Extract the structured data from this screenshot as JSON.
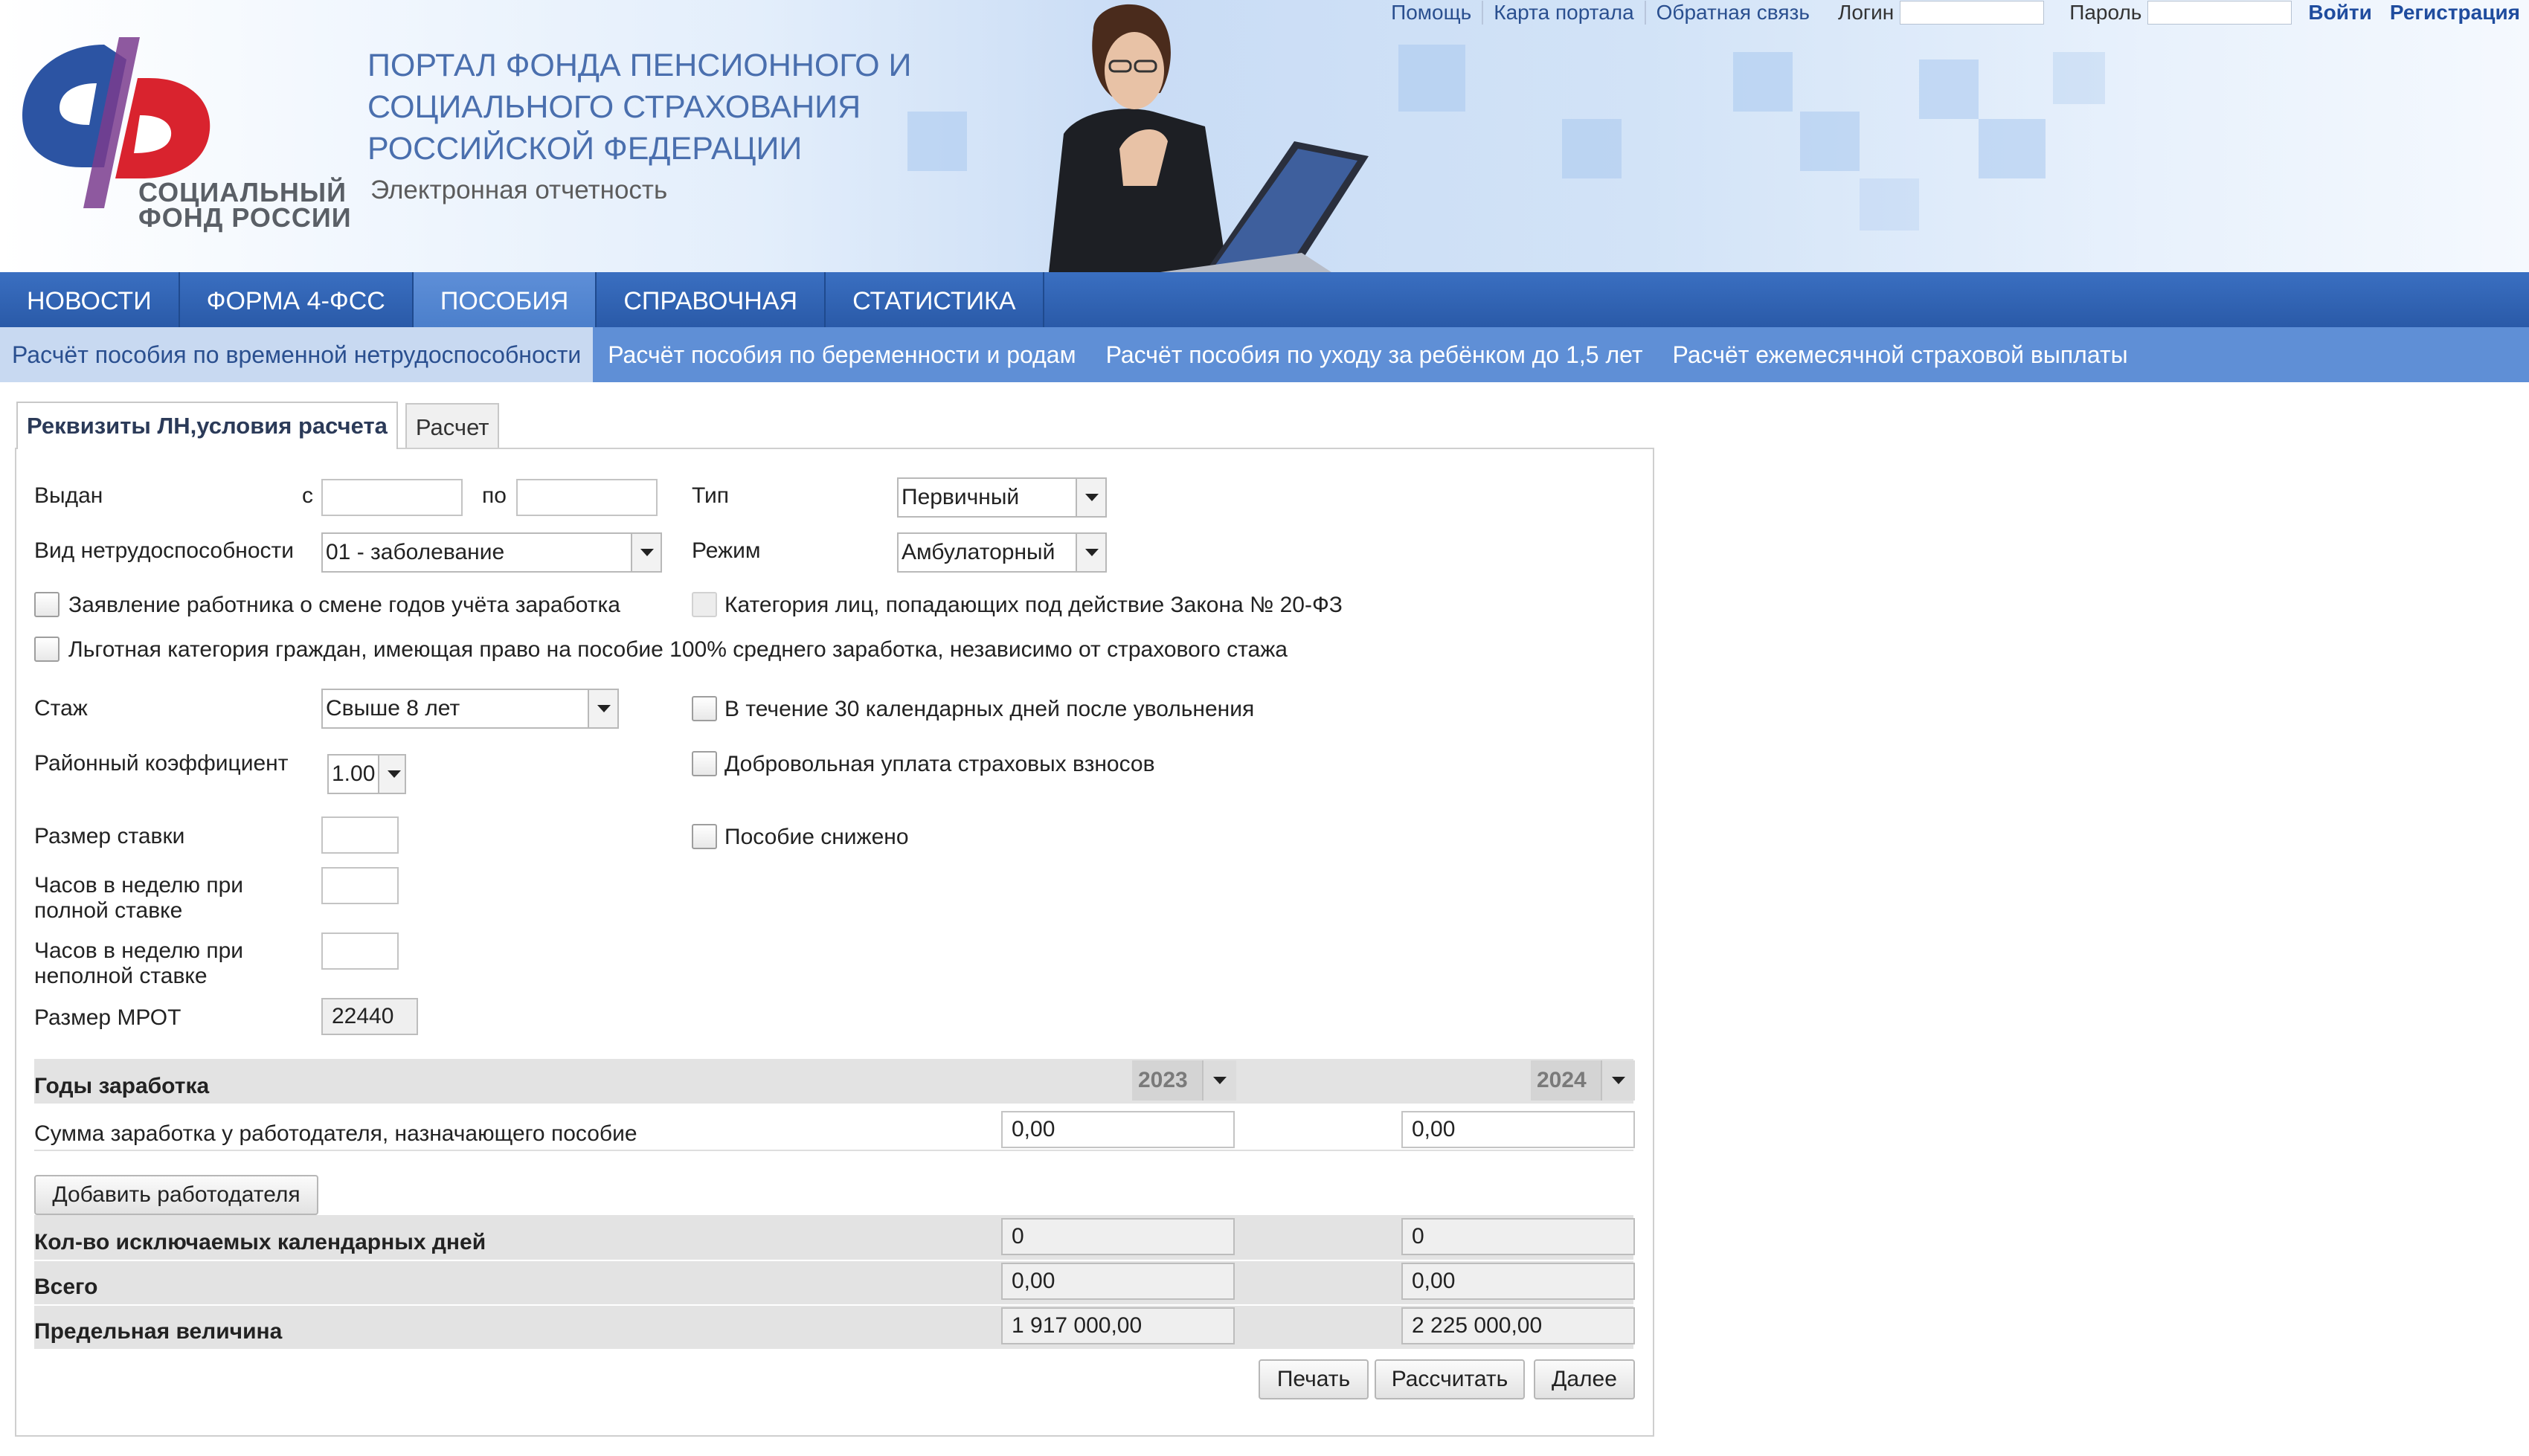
{
  "header": {
    "logo_text_line1": "СОЦИАЛЬНЫЙ",
    "logo_text_line2": "ФОНД РОССИИ",
    "portal_title": "ПОРТАЛ ФОНДА ПЕНСИОННОГО И СОЦИАЛЬНОГО СТРАХОВАНИЯ РОССИЙСКОЙ ФЕДЕРАЦИИ",
    "portal_subtitle": "Электронная отчетность",
    "links": [
      "Помощь",
      "Карта портала",
      "Обратная связь"
    ],
    "login_label": "Логин",
    "password_label": "Пароль",
    "login_button": "Войти",
    "register_button": "Регистрация",
    "colors": {
      "title": "#4a6fae",
      "logo_blue": "#2c54a3",
      "logo_red": "#d9232e"
    }
  },
  "nav": {
    "items": [
      "НОВОСТИ",
      "ФОРМА 4-ФСС",
      "ПОСОБИЯ",
      "СПРАВОЧНАЯ",
      "СТАТИСТИКА"
    ],
    "active": "ПОСОБИЯ"
  },
  "subnav": {
    "items": [
      "Расчёт пособия по временной нетрудоспособности",
      "Расчёт пособия по беременности и родам",
      "Расчёт пособия по уходу за ребёнком до 1,5 лет",
      "Расчёт ежемесячной страховой выплаты"
    ]
  },
  "tabs": {
    "requisites": "Реквизиты ЛН,условия расчета",
    "calc": "Расчет"
  },
  "form": {
    "issued_label": "Выдан",
    "from_label": "с",
    "to_label": "по",
    "issued_from": "",
    "issued_to": "",
    "type_label": "Тип",
    "type_value": "Первичный",
    "disability_label": "Вид нетрудоспособности",
    "disability_value": "01 - заболевание",
    "mode_label": "Режим",
    "mode_value": "Амбулаторный",
    "chk_change_years": "Заявление работника о смене годов учёта заработка",
    "chk_law_20fz": "Категория лиц, попадающих под действие Закона № 20-ФЗ",
    "chk_privileged": "Льготная категория граждан, имеющая право на пособие 100% среднего заработка, независимо от страхового стажа",
    "experience_label": "Стаж",
    "experience_value": "Свыше 8 лет",
    "chk_30days": "В течение 30 календарных дней после увольнения",
    "regional_label": "Районный коэффициент",
    "regional_value": "1.00",
    "chk_voluntary": "Добровольная уплата страховых взносов",
    "rate_label": "Размер ставки",
    "chk_reduced": "Пособие снижено",
    "hours_full_label": "Часов в неделю при полной ставке",
    "hours_part_label": "Часов в неделю при неполной ставке",
    "mrot_label": "Размер МРОТ",
    "mrot_value": "22440"
  },
  "earnings": {
    "years_label": "Годы заработка",
    "year1": "2023",
    "year2": "2024",
    "employer_sum_label": "Сумма заработка у работодателя, назначающего пособие",
    "employer_sum_1": "0,00",
    "employer_sum_2": "0,00",
    "add_employer_button": "Добавить работодателя",
    "excluded_days_label": "Кол-во исключаемых календарных дней",
    "excluded_days_1": "0",
    "excluded_days_2": "0",
    "total_label": "Всего",
    "total_1": "0,00",
    "total_2": "0,00",
    "limit_label": "Предельная величина",
    "limit_1": "1 917 000,00",
    "limit_2": "2 225 000,00"
  },
  "buttons": {
    "print": "Печать",
    "calculate": "Рассчитать",
    "next": "Далее"
  }
}
